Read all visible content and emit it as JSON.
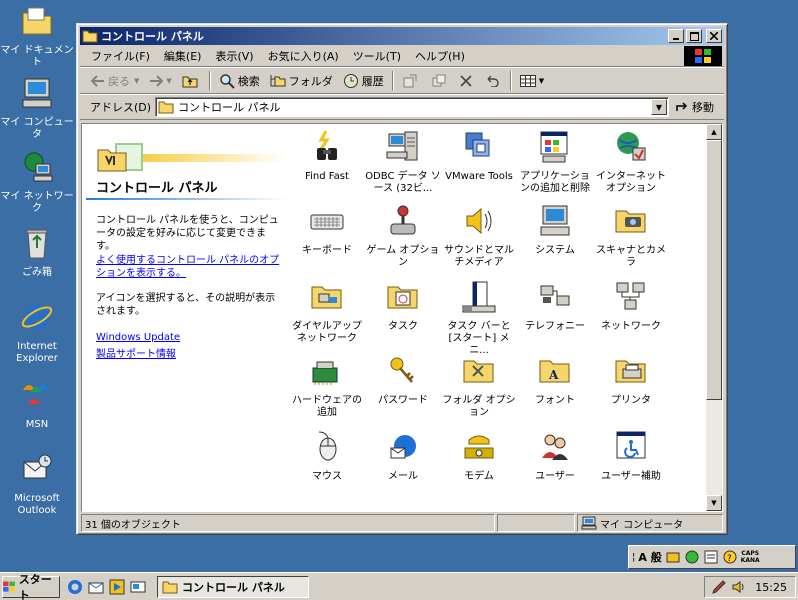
{
  "desktop": {
    "icons": [
      {
        "label": "マイ ドキュメント",
        "icon": "my-documents-icon"
      },
      {
        "label": "マイ コンピュータ",
        "icon": "my-computer-icon"
      },
      {
        "label": "マイ ネットワーク",
        "icon": "network-icon"
      },
      {
        "label": "ごみ箱",
        "icon": "recycle-bin-icon"
      },
      {
        "label": "Internet Explorer",
        "icon": "internet-explorer-icon"
      },
      {
        "label": "MSN",
        "icon": "msn-icon"
      },
      {
        "label": "Microsoft Outlook",
        "icon": "outlook-icon"
      }
    ]
  },
  "window": {
    "title": "コントロール パネル",
    "menu": [
      "ファイル(F)",
      "編集(E)",
      "表示(V)",
      "お気に入り(A)",
      "ツール(T)",
      "ヘルプ(H)"
    ],
    "toolbar": {
      "back": "戻る",
      "search": "検索",
      "folders": "フォルダ",
      "history": "履歴"
    },
    "address": {
      "label": "アドレス(D)",
      "value": "コントロール パネル",
      "go": "移動"
    },
    "left_pane": {
      "title": "コントロール パネル",
      "desc": "コントロール パネルを使うと、コンピュータの設定を好みに応じて変更できます。",
      "link_often": "よく使用するコントロール パネルのオプションを表示する。",
      "hint": "アイコンを選択すると、その説明が表示されます。",
      "link_update": "Windows Update",
      "link_support": "製品サポート情報"
    },
    "items": [
      {
        "label": "Find Fast",
        "icon": "find-fast-icon"
      },
      {
        "label": "ODBC データ ソース (32ビ...",
        "icon": "odbc-icon"
      },
      {
        "label": "VMware Tools",
        "icon": "vmware-icon"
      },
      {
        "label": "アプリケーションの追加と削除",
        "icon": "add-remove-programs-icon"
      },
      {
        "label": "インターネット オプション",
        "icon": "internet-options-icon"
      },
      {
        "label": "キーボード",
        "icon": "keyboard-icon"
      },
      {
        "label": "ゲーム オプション",
        "icon": "game-controller-icon"
      },
      {
        "label": "サウンドとマルチメディア",
        "icon": "speaker-icon"
      },
      {
        "label": "システム",
        "icon": "system-icon"
      },
      {
        "label": "スキャナとカメラ",
        "icon": "scanner-camera-icon"
      },
      {
        "label": "ダイヤルアップ ネットワーク",
        "icon": "dialup-icon"
      },
      {
        "label": "タスク",
        "icon": "scheduled-tasks-icon"
      },
      {
        "label": "タスク バーと [スタート] メニ...",
        "icon": "taskbar-icon"
      },
      {
        "label": "テレフォニー",
        "icon": "telephony-icon"
      },
      {
        "label": "ネットワーク",
        "icon": "network-icon"
      },
      {
        "label": "ハードウェアの追加",
        "icon": "add-hardware-icon"
      },
      {
        "label": "パスワード",
        "icon": "passwords-icon"
      },
      {
        "label": "フォルダ オプション",
        "icon": "folder-options-icon"
      },
      {
        "label": "フォント",
        "icon": "fonts-icon"
      },
      {
        "label": "プリンタ",
        "icon": "printers-icon"
      },
      {
        "label": "マウス",
        "icon": "mouse-icon"
      },
      {
        "label": "メール",
        "icon": "mail-icon"
      },
      {
        "label": "モデム",
        "icon": "modem-icon"
      },
      {
        "label": "ユーザー",
        "icon": "users-icon"
      },
      {
        "label": "ユーザー補助",
        "icon": "accessibility-icon"
      }
    ],
    "status": {
      "count": "31 個のオブジェクト",
      "zone": "マイ コンピュータ"
    }
  },
  "langbar": {
    "mode": "A 般",
    "caps": "CAPS",
    "kana": "KANA"
  },
  "taskbar": {
    "start": "スタート",
    "task": "コントロール パネル",
    "clock": "15:25"
  },
  "colors": {
    "desktop": "#3a6ea5",
    "title_active": "#0a246a",
    "link": "#0000ff"
  }
}
